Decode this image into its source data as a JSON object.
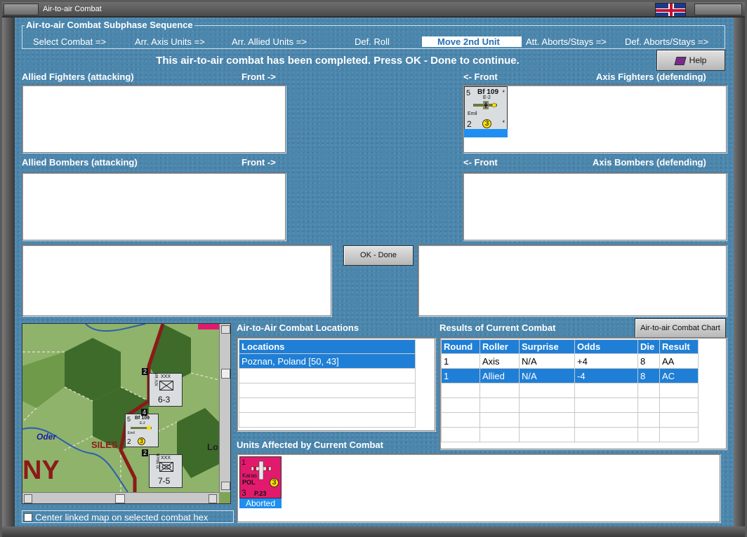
{
  "window": {
    "title": "Air-to-air Combat"
  },
  "phases": {
    "title": "Air-to-air Combat Subphase Sequence",
    "items": [
      "Select Combat =>",
      "Arr. Axis Units =>",
      "Arr. Allied Units =>",
      "Def. Roll",
      "Move 2nd Unit",
      "Att. Aborts/Stays =>",
      "Def. Aborts/Stays =>"
    ],
    "active_index": 4
  },
  "message": "This air-to-air combat has been completed.  Press OK - Done to continue.",
  "help_label": "Help",
  "sections": {
    "allied_fighters": "Allied Fighters (attacking)",
    "allied_fighters_front": "Front ->",
    "axis_fighters_front": "<- Front",
    "axis_fighters": "Axis Fighters (defending)",
    "allied_bombers": "Allied Bombers (attacking)",
    "allied_bombers_front": "Front ->",
    "axis_bombers_front": "<- Front",
    "axis_bombers": "Axis Bombers (defending)"
  },
  "axis_fighter_unit": {
    "name": "Bf 109",
    "variant": "E-2",
    "nickname": "Emil",
    "top_left": "5",
    "bottom_left": "2",
    "range": "3",
    "star": "*"
  },
  "ok_label": "OK - Done",
  "map": {
    "region_label": "SILES",
    "river_label": "Oder",
    "country_label": "NY",
    "city_label": "Lo",
    "unit1": {
      "type": "XIV Inf",
      "size": "XXX",
      "strength": "6-3",
      "stack": "2"
    },
    "unit2": {
      "type": "XI Mech",
      "size": "XXX",
      "strength": "7-5",
      "stack": "2"
    },
    "fighter": {
      "name": "Bf 109",
      "variant": "E-2",
      "nickname": "Emil",
      "top_left": "5",
      "bottom_left": "2",
      "range": "3",
      "stack": "4"
    },
    "link_checkbox_label": "Center linked map on selected combat hex",
    "colors": {
      "forest": "#3e6b2a",
      "border": "#8b1a1a",
      "river": "#2e5fb0"
    }
  },
  "locations": {
    "title": "Air-to-Air Combat Locations",
    "header": "Locations",
    "rows": [
      "Poznan, Poland [50, 43]",
      "",
      "",
      "",
      ""
    ],
    "selected_index": 0
  },
  "results": {
    "title": "Results of Current Combat",
    "chart_button": "Air-to-air Combat Chart",
    "columns": [
      "Round",
      "Roller",
      "Surprise",
      "Odds",
      "Die",
      "Result"
    ],
    "rows": [
      [
        "1",
        "Axis",
        "N/A",
        "+4",
        "8",
        "AA"
      ],
      [
        "1",
        "Allied",
        "N/A",
        "-4",
        "8",
        "AC"
      ],
      [
        "",
        "",
        "",
        "",
        "",
        ""
      ],
      [
        "",
        "",
        "",
        "",
        "",
        ""
      ],
      [
        "",
        "",
        "",
        "",
        "",
        ""
      ],
      [
        "",
        "",
        "",
        "",
        "",
        ""
      ]
    ],
    "selected_index": 1
  },
  "affected": {
    "title": "Units Affected by Current Combat",
    "unit": {
      "name": "P.23",
      "nickname": "Karas",
      "nation": "POL",
      "top_left": "1",
      "bottom_left": "3",
      "range": "3",
      "status": "Aborted",
      "color": "#e21a6e"
    }
  }
}
